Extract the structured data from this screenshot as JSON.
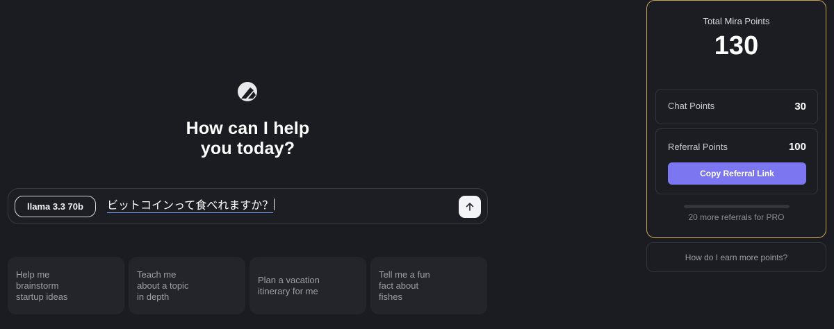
{
  "hero": {
    "logo_icon": "mira-logo-icon",
    "title_line1": "How can I help",
    "title_line2": "you today?"
  },
  "prompt": {
    "model": "llama 3.3 70b",
    "input_value": "ビットコインって食べれますか？",
    "send_icon": "arrow-up-icon"
  },
  "suggestions": [
    {
      "label": "Help me\nbrainstorm\nstartup ideas"
    },
    {
      "label": "Teach me\nabout a topic\nin depth"
    },
    {
      "label": "Plan a vacation\nitinerary for me"
    },
    {
      "label": "Tell me a fun\nfact about\nfishes"
    }
  ],
  "points": {
    "total_label": "Total Mira Points",
    "total_value": "130",
    "chat_label": "Chat Points",
    "chat_value": "30",
    "referral_label": "Referral Points",
    "referral_value": "100",
    "copy_referral_label": "Copy Referral Link",
    "progress_fraction": 0,
    "progress_note": "20 more referrals for PRO",
    "earn_more_label": "How do I earn more points?"
  },
  "colors": {
    "background": "#1b1c21",
    "card_border_gold": "#c7a552",
    "accent_purple": "#7c76f0"
  }
}
